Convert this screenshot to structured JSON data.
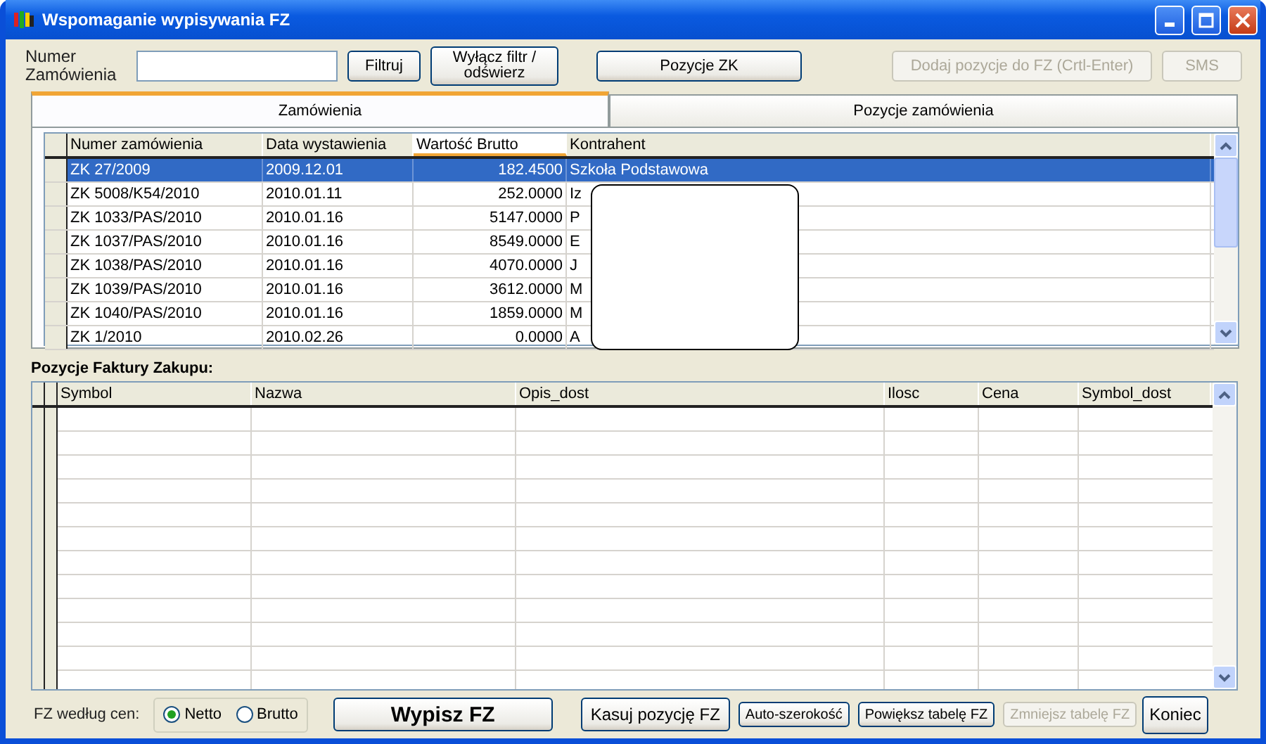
{
  "window": {
    "title": "Wspomaganie wypisywania FZ"
  },
  "filter": {
    "label": "Numer Zamówienia",
    "buttons": [
      {
        "label": "Filtruj",
        "disabled": false
      },
      {
        "label": "Wyłącz filtr / odświerz",
        "disabled": false
      },
      {
        "label": "Pozycje ZK",
        "disabled": false
      }
    ]
  },
  "actions": [
    {
      "label": "Dodaj pozycje do FZ (Crtl-Enter)",
      "disabled": true
    },
    {
      "label": "SMS",
      "disabled": true
    }
  ],
  "tabs": [
    {
      "label": "Zamówienia",
      "selected": true
    },
    {
      "label": "Pozycje zamówienia",
      "selected": false
    }
  ],
  "orders": {
    "columns": [
      {
        "label": "Numer zamówienia",
        "sorted": false
      },
      {
        "label": "Data wystawienia",
        "sorted": false
      },
      {
        "label": "Wartość Brutto",
        "sorted": true
      },
      {
        "label": "Kontrahent",
        "sorted": false
      }
    ],
    "rows": [
      {
        "cells": [
          "ZK 27/2009",
          "2009.12.01",
          "182.4500",
          "Szkoła Podstawowa"
        ],
        "selected": true
      },
      {
        "cells": [
          "ZK 5008/K54/2010",
          "2010.01.11",
          "252.0000",
          "Iz"
        ],
        "selected": false
      },
      {
        "cells": [
          "ZK 1033/PAS/2010",
          "2010.01.16",
          "5147.0000",
          "P"
        ],
        "selected": false
      },
      {
        "cells": [
          "ZK 1037/PAS/2010",
          "2010.01.16",
          "8549.0000",
          "E"
        ],
        "selected": false
      },
      {
        "cells": [
          "ZK 1038/PAS/2010",
          "2010.01.16",
          "4070.0000",
          "J"
        ],
        "selected": false
      },
      {
        "cells": [
          "ZK 1039/PAS/2010",
          "2010.01.16",
          "3612.0000",
          "M"
        ],
        "selected": false
      },
      {
        "cells": [
          "ZK 1040/PAS/2010",
          "2010.01.16",
          "1859.0000",
          "M"
        ],
        "selected": false
      },
      {
        "cells": [
          "ZK 1/2010",
          "2010.02.26",
          "0.0000",
          "A"
        ],
        "selected": false
      }
    ]
  },
  "invoice": {
    "title": "Pozycje Faktury Zakupu:",
    "columns": [
      "Symbol",
      "Nazwa",
      "Opis_dost",
      "Ilosc",
      "Cena",
      "Symbol_dost"
    ]
  },
  "bottom": {
    "label": "FZ według cen:",
    "radios": [
      {
        "label": "Netto",
        "selected": true
      },
      {
        "label": "Brutto",
        "selected": false
      }
    ],
    "buttons": [
      {
        "label": "Wypisz FZ",
        "kind": "primary",
        "disabled": false
      },
      {
        "label": "Kasuj pozycję FZ",
        "kind": "normal",
        "disabled": false
      },
      {
        "label": "Auto-szerokość",
        "kind": "small",
        "disabled": false
      },
      {
        "label": "Powiększ tabelę FZ",
        "kind": "small",
        "disabled": false
      },
      {
        "label": "Zmniejsz tabelę FZ",
        "kind": "small",
        "disabled": true
      },
      {
        "label": "Koniec",
        "kind": "end",
        "disabled": false
      }
    ]
  }
}
